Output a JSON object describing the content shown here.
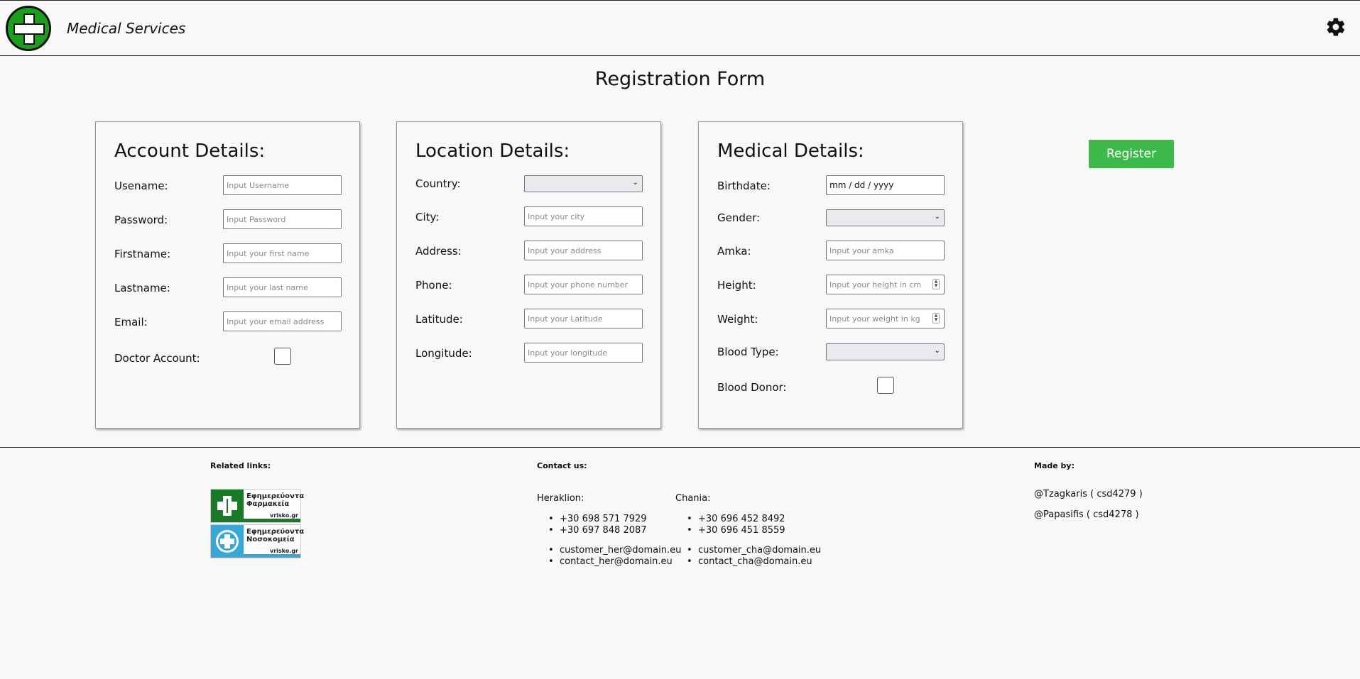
{
  "header": {
    "brand": "Medical Services"
  },
  "page_title": "Registration Form",
  "account": {
    "title": "Account Details:",
    "fields": [
      {
        "label": "Usename:",
        "placeholder": "Input Username"
      },
      {
        "label": "Password:",
        "placeholder": "Input Password"
      },
      {
        "label": "Firstname:",
        "placeholder": "Input your first name"
      },
      {
        "label": "Lastname:",
        "placeholder": "Input your last name"
      },
      {
        "label": "Email:",
        "placeholder": "Input your email address"
      }
    ],
    "doctor_label": "Doctor Account:"
  },
  "location": {
    "title": "Location Details:",
    "country_label": "Country:",
    "country_value": "",
    "fields": [
      {
        "label": "City:",
        "placeholder": "Input your city"
      },
      {
        "label": "Address:",
        "placeholder": "Input your address"
      },
      {
        "label": "Phone:",
        "placeholder": "Input your phone number"
      },
      {
        "label": "Latitude:",
        "placeholder": "Input your Latitude"
      },
      {
        "label": "Longitude:",
        "placeholder": "Input your longitude"
      }
    ]
  },
  "medical": {
    "title": "Medical Details:",
    "birthdate_label": "Birthdate:",
    "birthdate_value": "mm / dd / yyyy",
    "gender_label": "Gender:",
    "gender_value": "",
    "amka_label": "Amka:",
    "amka_placeholder": "Input your amka",
    "height_label": "Height:",
    "height_placeholder": "Input your height in cm",
    "weight_label": "Weight:",
    "weight_placeholder": "Input your weight in kg",
    "blood_type_label": "Blood Type:",
    "blood_type_value": "",
    "blood_donor_label": "Blood Donor:"
  },
  "register_label": "Register",
  "footer": {
    "related_title": "Related links:",
    "badges": [
      {
        "line1": "Εφημερεύοντα",
        "line2": "Φαρμακεία",
        "brand": "vrisko.gr",
        "color": "#1b7a2a"
      },
      {
        "line1": "Εφημερεύοντα",
        "line2": "Νοσοκομεία",
        "brand": "vrisko.gr",
        "color": "#39a7d3"
      }
    ],
    "contact_title": "Contact us:",
    "heraklion": {
      "city": "Heraklion:",
      "phones": [
        "+30 698 571 7929",
        "+30 697 848 2087"
      ],
      "emails": [
        "customer_her@domain.eu",
        "contact_her@domain.eu"
      ]
    },
    "chania": {
      "city": "Chania:",
      "phones": [
        "+30 696 452 8492",
        "+30 696 451 8559"
      ],
      "emails": [
        "customer_cha@domain.eu",
        "contact_cha@domain.eu"
      ]
    },
    "made_title": "Made by:",
    "authors": [
      "@Tzagkaris ( csd4279 )",
      "@Papasifis ( csd4278 )"
    ]
  }
}
